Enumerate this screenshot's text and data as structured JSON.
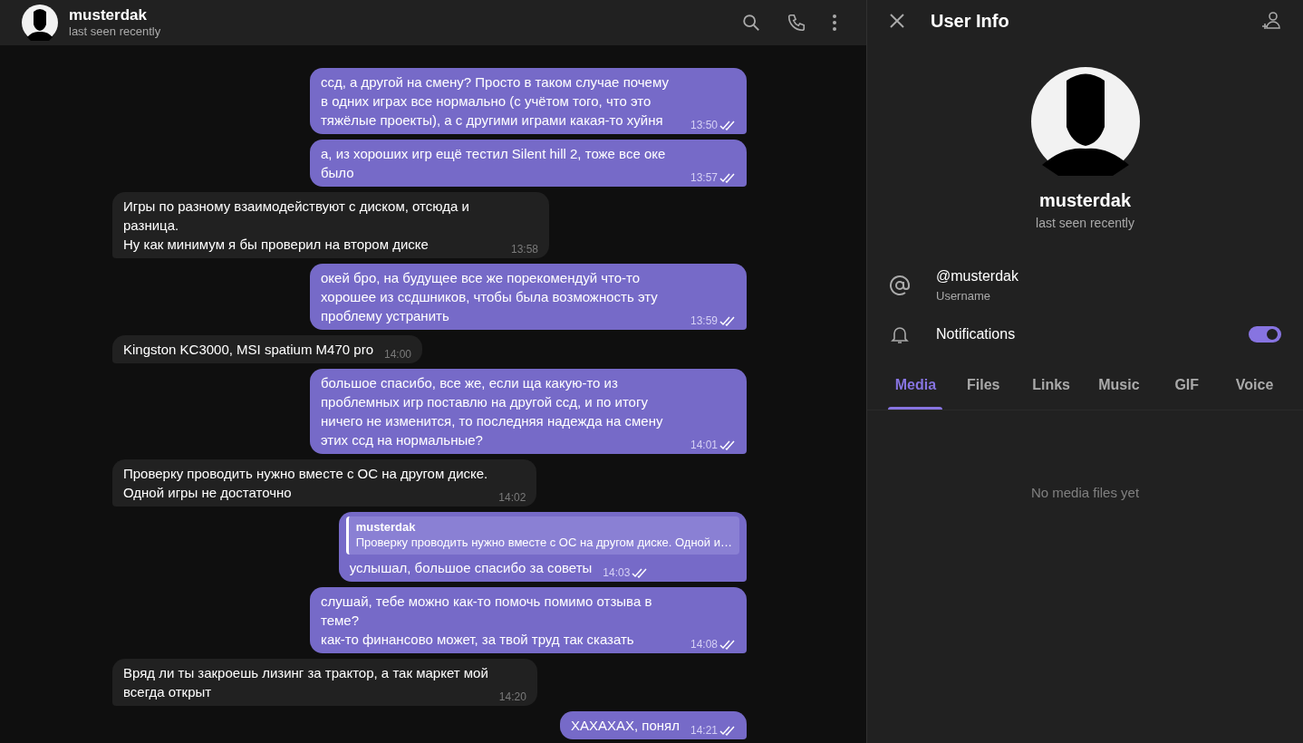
{
  "chat_header": {
    "name": "musterdak",
    "status": "last seen recently"
  },
  "messages": [
    {
      "kind": "out",
      "text": "ссд, а другой на смену? Просто в таком случае почему в одних играх все нормально (с учётом того, что это тяжёлые проекты), а с другими играми какая-то хуйня",
      "time": "13:50"
    },
    {
      "kind": "out",
      "text": "а, из хороших игр ещё тестил Silent hill 2, тоже все оке было",
      "time": "13:57"
    },
    {
      "kind": "in",
      "text": "Игры по разному взаимодействуют с диском, отсюда и разница.\nНу как минимум я бы проверил на втором диске",
      "time": "13:58"
    },
    {
      "kind": "out",
      "text": "окей бро, на будущее все же порекомендуй что-то хорошее из ссдшников, чтобы была возможность эту проблему устранить",
      "time": "13:59"
    },
    {
      "kind": "in",
      "text": "Kingston KC3000, MSI spatium M470 pro",
      "time": "14:00"
    },
    {
      "kind": "out",
      "text": "большое спасибо, все же, если ща какую-то из проблемных игр поставлю на другой ссд, и по итогу ничего не изменится, то последняя надежда на смену этих ссд на нормальные?",
      "time": "14:01"
    },
    {
      "kind": "in",
      "text": "Проверку проводить нужно вместе с ОС на другом диске.\nОдной игры не достаточно",
      "time": "14:02"
    },
    {
      "kind": "out",
      "reply": {
        "name": "musterdak",
        "text": "Проверку проводить нужно вместе с ОС на другом диске. Одной и…"
      },
      "text": "услышал, большое спасибо за советы",
      "time": "14:03"
    },
    {
      "kind": "out",
      "text": "слушай, тебе можно как-то помочь помимо отзыва в теме?\nкак-то финансово может, за твой труд так сказать",
      "time": "14:08"
    },
    {
      "kind": "in",
      "text": "Вряд ли ты закроешь лизинг за трактор, а так маркет мой\nвсегда открыт",
      "time": "14:20"
    },
    {
      "kind": "out",
      "text": "ХАХАХАХ, понял",
      "time": "14:21"
    }
  ],
  "user_info": {
    "title": "User Info",
    "name": "musterdak",
    "status": "last seen recently",
    "username": {
      "value": "@musterdak",
      "label": "Username"
    },
    "notifications": {
      "label": "Notifications",
      "on": true
    },
    "tabs": [
      {
        "label": "Media",
        "selected": true
      },
      {
        "label": "Files",
        "selected": false
      },
      {
        "label": "Links",
        "selected": false
      },
      {
        "label": "Music",
        "selected": false
      },
      {
        "label": "GIF",
        "selected": false
      },
      {
        "label": "Voice",
        "selected": false
      }
    ],
    "empty_text": "No media files yet"
  }
}
